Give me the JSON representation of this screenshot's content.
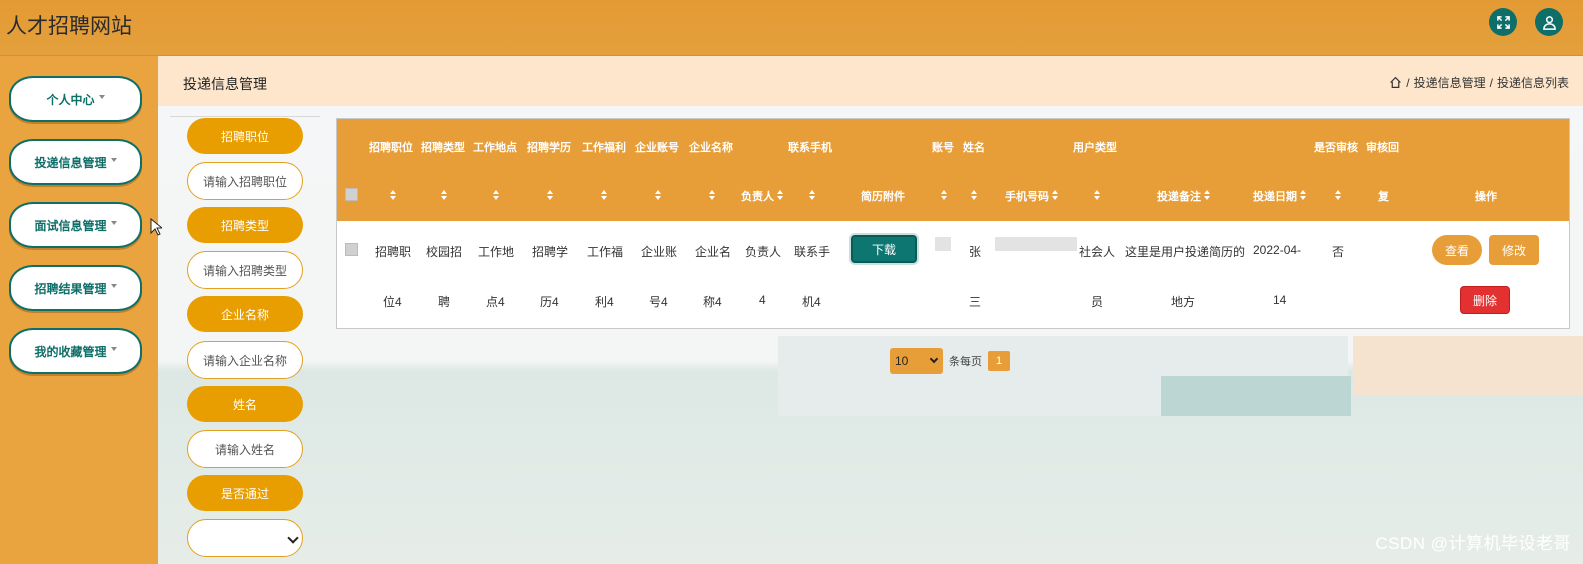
{
  "header": {
    "site_title": "人才招聘网站"
  },
  "sidebar": {
    "items": [
      {
        "label": "个人中心"
      },
      {
        "label": "投递信息管理"
      },
      {
        "label": "面试信息管理"
      },
      {
        "label": "招聘结果管理"
      },
      {
        "label": "我的收藏管理"
      }
    ]
  },
  "page": {
    "title": "投递信息管理",
    "breadcrumb": [
      "投递信息管理",
      "投递信息列表"
    ],
    "breadcrumb_sep": "/"
  },
  "search": {
    "fields": [
      {
        "label": "招聘职位",
        "placeholder": "请输入招聘职位"
      },
      {
        "label": "招聘类型",
        "placeholder": "请输入招聘类型"
      },
      {
        "label": "企业名称",
        "placeholder": "请输入企业名称"
      },
      {
        "label": "姓名",
        "placeholder": "请输入姓名"
      },
      {
        "label": "是否通过",
        "placeholder": ""
      }
    ]
  },
  "table": {
    "headers_top": {
      "position": "招聘职位",
      "type": "招聘类型",
      "location": "工作地点",
      "education": "招聘学历",
      "welfare": "工作福利",
      "company_account": "企业账号",
      "company_name": "企业名称",
      "contact_phone": "联系手机",
      "account": "账号",
      "name": "姓名",
      "user_type": "用户类型",
      "reviewed": "是否审核",
      "review_reply": "审核回"
    },
    "headers_bottom": {
      "manager": "负责人",
      "resume": "简历附件",
      "mobile": "手机号码",
      "note": "投递备注",
      "date": "投递日期",
      "reply_cont": "复",
      "actions": "操作"
    },
    "row": {
      "position": [
        "招聘职",
        "位4"
      ],
      "type": [
        "校园招",
        "聘"
      ],
      "location": [
        "工作地",
        "点4"
      ],
      "education": [
        "招聘学",
        "历4"
      ],
      "welfare": [
        "工作福",
        "利4"
      ],
      "company_account": [
        "企业账",
        "号4"
      ],
      "company_name": [
        "企业名",
        "称4"
      ],
      "manager": [
        "负责人",
        "4"
      ],
      "contact_phone": [
        "联系手",
        "机4"
      ],
      "name": [
        "张",
        "三"
      ],
      "user_type": [
        "社会人",
        "员"
      ],
      "note": [
        "这里是用户投递简历的",
        "地方"
      ],
      "date": [
        "2022-04-",
        "14"
      ],
      "reviewed": "否"
    },
    "buttons": {
      "download": "下载",
      "view": "查看",
      "edit": "修改",
      "delete": "删除"
    }
  },
  "pagination": {
    "page_size": "10",
    "per_page_label": "条每页",
    "current_page": "1"
  },
  "watermark": "CSDN @计算机毕设老哥",
  "colors": {
    "accent": "#e89e38",
    "teal": "#0e6e68",
    "danger": "#e33030"
  }
}
